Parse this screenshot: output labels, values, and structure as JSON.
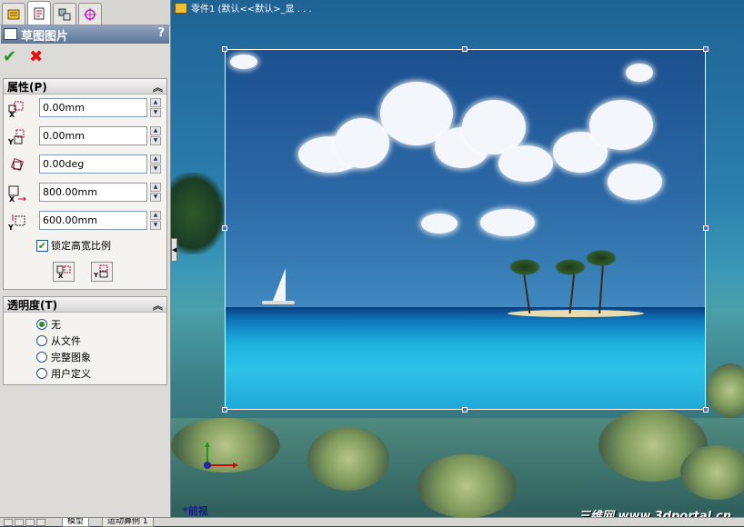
{
  "tabs": [
    {
      "name": "featuremanager-tab",
      "icon": "featuremanager-icon"
    },
    {
      "name": "propertymanager-tab",
      "icon": "propertymanager-icon",
      "active": true
    },
    {
      "name": "configurationmanager-tab",
      "icon": "configurationmanager-icon"
    },
    {
      "name": "dimxpert-tab",
      "icon": "target-icon"
    }
  ],
  "panel": {
    "title": "草图图片",
    "help": "?",
    "ok_icon": "✔",
    "cancel_icon": "✖",
    "properties": {
      "header": "属性(P)",
      "collapse": "︽",
      "fields": [
        {
          "icon": "x-position-icon",
          "value": "0.00mm"
        },
        {
          "icon": "y-position-icon",
          "value": "0.00mm"
        },
        {
          "icon": "angle-icon",
          "value": "0.00deg"
        },
        {
          "icon": "width-icon",
          "value": "800.00mm"
        },
        {
          "icon": "height-icon",
          "value": "600.00mm"
        }
      ],
      "lock_aspect_label": "锁定高宽比例",
      "lock_aspect_checked": true,
      "flip_horizontal_label": "X",
      "flip_vertical_label": "Y"
    },
    "transparency": {
      "header": "透明度(T)",
      "collapse": "︽",
      "options": [
        "无",
        "从文件",
        "完整图象",
        "用户定义"
      ],
      "selected": "无"
    }
  },
  "viewport": {
    "tree_label": "零件1  (默认<<默认>_显 . . .",
    "view_name": "*前视",
    "watermark": "三维网 www.3dportal.cn"
  },
  "bottom_tabs": [
    "模型",
    "运动算例 1"
  ],
  "colors": {
    "accent_title": "#5e7598",
    "ok": "#1d9a1d",
    "cancel": "#d11111",
    "handle": "#4a73c9"
  }
}
